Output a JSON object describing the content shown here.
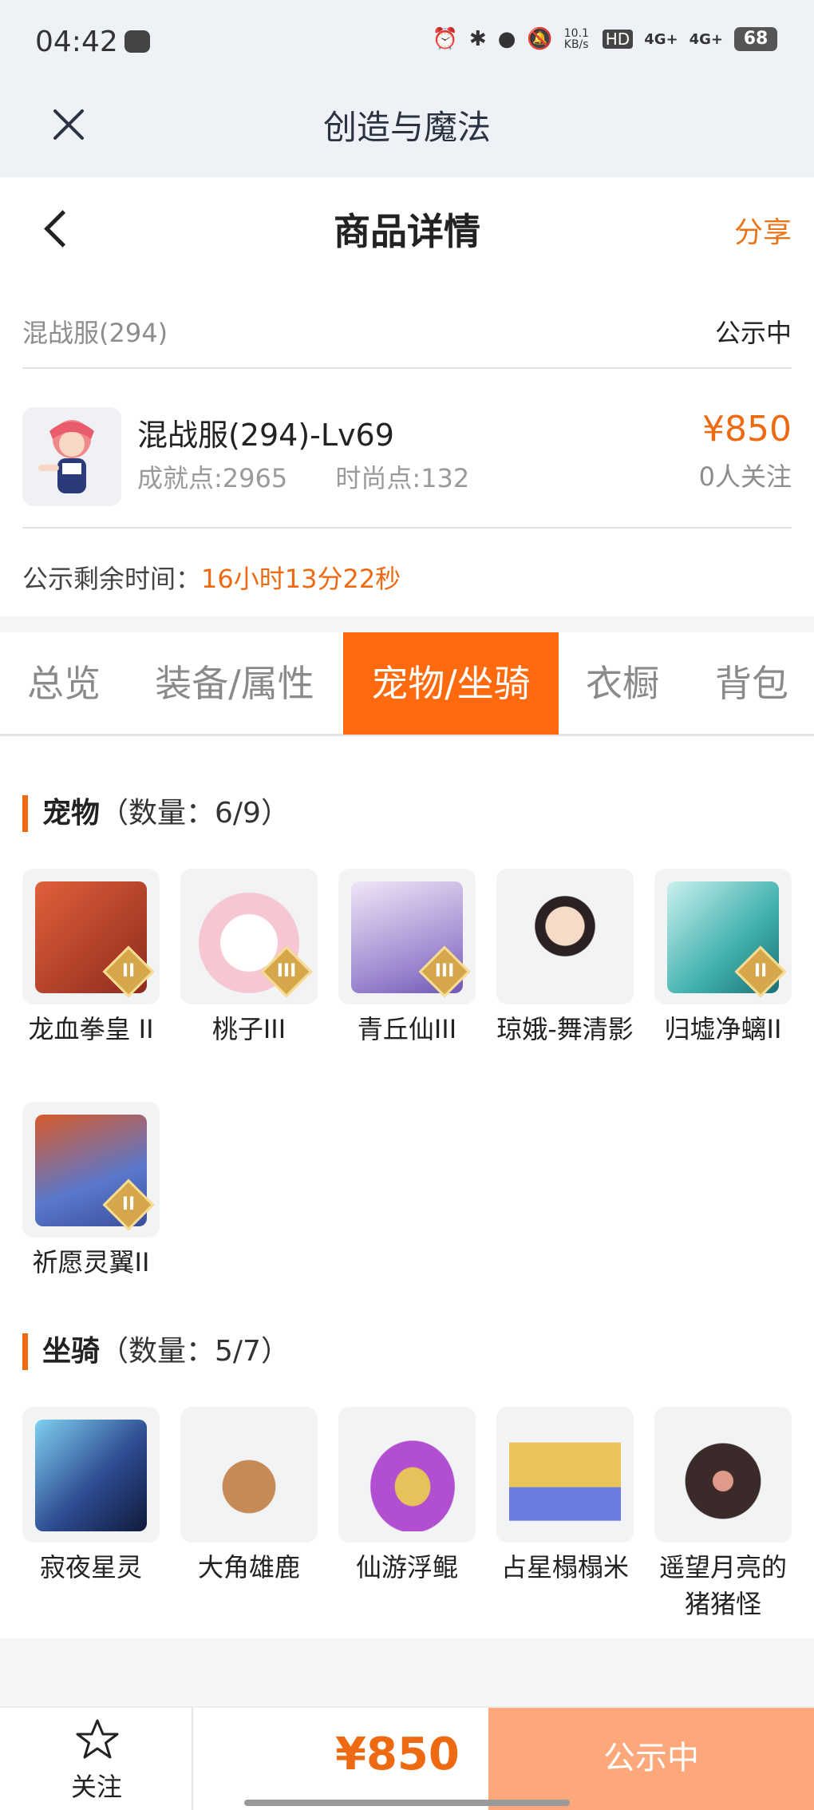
{
  "status_bar": {
    "time": "04:42",
    "network_speed": "10.1\nKB/s",
    "hd": "HD",
    "sim1": "4G+",
    "sim2": "4G+",
    "battery": "68"
  },
  "webview": {
    "title": "创造与魔法"
  },
  "header": {
    "title": "商品详情",
    "share": "分享"
  },
  "listing": {
    "server": "混战服(294)",
    "status": "公示中",
    "product_title": "混战服(294)-Lv69",
    "achievement": "成就点:2965",
    "fashion": "时尚点:132",
    "price": "¥850",
    "follows": "0人关注",
    "remain_label": "公示剩余时间：",
    "remain_value": "16小时13分22秒"
  },
  "tabs": [
    {
      "label": "总览",
      "active": false
    },
    {
      "label": "装备/属性",
      "active": false
    },
    {
      "label": "宠物/坐骑",
      "active": true
    },
    {
      "label": "衣橱",
      "active": false
    },
    {
      "label": "背包",
      "active": false
    }
  ],
  "pets": {
    "title": "宠物",
    "count": "（数量：6/9）",
    "items": [
      {
        "name": "龙血拳皇 II",
        "badge": "II",
        "color": "#c0432b"
      },
      {
        "name": "桃子III",
        "badge": "III",
        "color": "#f5b9c8"
      },
      {
        "name": "青丘仙III",
        "badge": "III",
        "color": "#b7a3d8"
      },
      {
        "name": "琼娥-舞清影",
        "badge": "",
        "color": "#e9d6c7"
      },
      {
        "name": "归墟净螭II",
        "badge": "II",
        "color": "#49b8b6"
      },
      {
        "name": "祈愿灵翼II",
        "badge": "II",
        "color": "#5b76c9"
      }
    ]
  },
  "mounts": {
    "title": "坐骑",
    "count": "（数量：5/7）",
    "items": [
      {
        "name": "寂夜星灵",
        "color": "#2e4c92"
      },
      {
        "name": "大角雄鹿",
        "color": "#a36a3c"
      },
      {
        "name": "仙游浮鲲",
        "color": "#9b3fb3"
      },
      {
        "name": "占星榻榻米",
        "color": "#d9b347"
      },
      {
        "name": "遥望月亮的猪猪怪",
        "color": "#5a3b36"
      }
    ]
  },
  "bottom_bar": {
    "follow_label": "关注",
    "price": "¥850",
    "action": "公示中"
  }
}
